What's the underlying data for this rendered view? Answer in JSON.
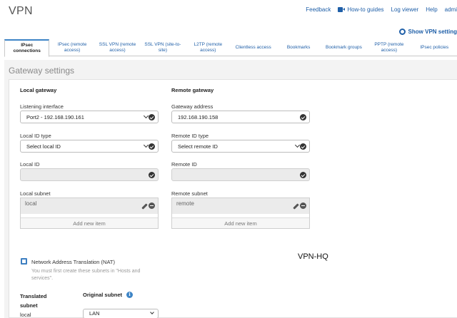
{
  "page": {
    "title": "VPN"
  },
  "topnav": {
    "feedback": "Feedback",
    "how_to_guides": "How-to guides",
    "log_viewer": "Log viewer",
    "help": "Help",
    "user": "admi"
  },
  "show_settings_label": "Show VPN setting",
  "tabs": [
    {
      "label": "IPsec connections",
      "active": true
    },
    {
      "label": "IPsec (remote access)",
      "active": false
    },
    {
      "label": "SSL VPN (remote access)",
      "active": false
    },
    {
      "label": "SSL VPN (site-to-site)",
      "active": false
    },
    {
      "label": "L2TP (remote access)",
      "active": false
    },
    {
      "label": "Clientless access",
      "active": false
    },
    {
      "label": "Bookmarks",
      "active": false
    },
    {
      "label": "Bookmark groups",
      "active": false
    },
    {
      "label": "PPTP (remote access)",
      "active": false
    },
    {
      "label": "IPsec policies",
      "active": false
    }
  ],
  "section": {
    "title": "Gateway settings"
  },
  "local": {
    "title": "Local gateway",
    "listening_interface_label": "Listening interface",
    "listening_interface_value": "Port2 - 192.168.190.161",
    "id_type_label": "Local ID type",
    "id_type_value": "Select local ID",
    "id_label": "Local ID",
    "id_value": "",
    "subnet_label": "Local subnet",
    "subnet_item": "local",
    "add_item": "Add new item"
  },
  "remote": {
    "title": "Remote gateway",
    "address_label": "Gateway address",
    "address_value": "192.168.190.158",
    "id_type_label": "Remote ID type",
    "id_type_value": "Select remote ID",
    "id_label": "Remote ID",
    "id_value": "",
    "subnet_label": "Remote subnet",
    "subnet_item": "remote",
    "add_item": "Add new item"
  },
  "nat": {
    "label": "Network Address Translation (NAT)",
    "checked": true,
    "hint": "You must first create these subnets in \"Hosts and services\"."
  },
  "annotation": "VPN-HQ",
  "translation": {
    "translated_subnet_label": "Translated subnet",
    "original_subnet_label": "Original subnet",
    "row_local": "local",
    "original_value": "LAN"
  },
  "colors": {
    "accent": "#3d84c6",
    "link": "#1f5fa8"
  }
}
